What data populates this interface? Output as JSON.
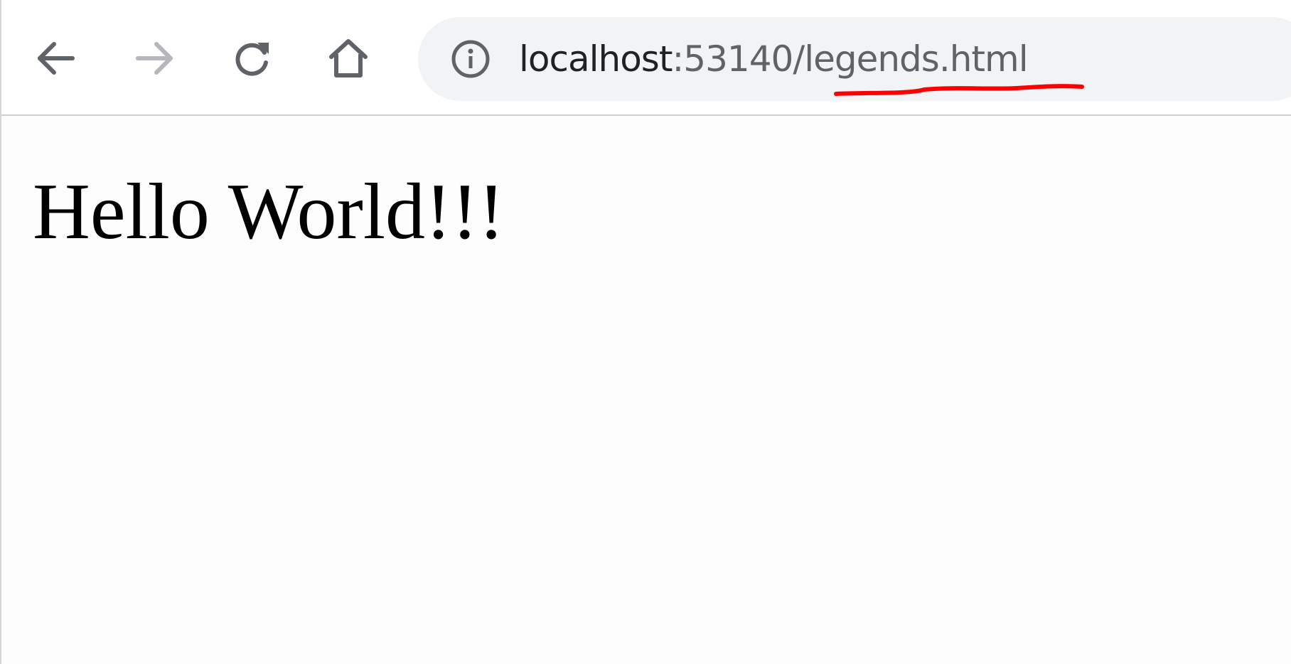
{
  "toolbar": {
    "back_icon": "back-arrow-icon",
    "forward_icon": "forward-arrow-icon",
    "reload_icon": "reload-icon",
    "home_icon": "home-icon"
  },
  "omnibox": {
    "info_icon": "info-icon",
    "url_host": "localhost",
    "url_rest": ":53140/legends.html"
  },
  "annotation": {
    "color": "#ff0000"
  },
  "page": {
    "heading": "Hello World!!!"
  }
}
